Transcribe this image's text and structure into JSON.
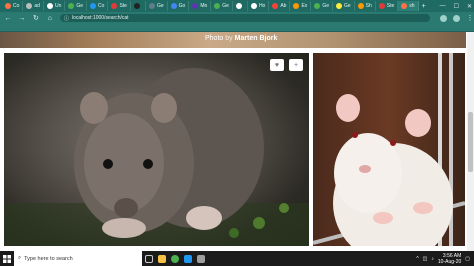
{
  "browser": {
    "tabs": [
      {
        "label": "Co",
        "color": "#ff7043"
      },
      {
        "label": "ad",
        "color": "#bdbdbd"
      },
      {
        "label": "Un",
        "color": "#ffffff"
      },
      {
        "label": "Ge",
        "color": "#4caf50"
      },
      {
        "label": "Co",
        "color": "#2196f3"
      },
      {
        "label": "Ste",
        "color": "#e53935"
      },
      {
        "label": "",
        "color": "#212121"
      },
      {
        "label": "Ge",
        "color": "#607d8b"
      },
      {
        "label": "Go",
        "color": "#4285f4"
      },
      {
        "label": "Mo",
        "color": "#5e35b1"
      },
      {
        "label": "Ge",
        "color": "#4caf50"
      },
      {
        "label": "",
        "color": "#ffffff"
      },
      {
        "label": "Ho",
        "color": "#ffffff"
      },
      {
        "label": "Ab",
        "color": "#f44336"
      },
      {
        "label": "Ex",
        "color": "#ff9800"
      },
      {
        "label": "Ge",
        "color": "#4caf50"
      },
      {
        "label": "Ge",
        "color": "#ffeb3b"
      },
      {
        "label": "Sh",
        "color": "#ff9800"
      },
      {
        "label": "Ste",
        "color": "#e53935"
      },
      {
        "label": "sh",
        "color": "#ff7043"
      }
    ],
    "new_tab": "+",
    "window_controls": {
      "minimize": "—",
      "maximize": "☐",
      "close": "✕"
    },
    "url": "localhost:1000/search/cat"
  },
  "page": {
    "banner_credit": {
      "prefix": "Photo",
      "by": "by",
      "author": "Marten Bjork"
    },
    "photo_actions": {
      "like": "♥",
      "add": "+"
    }
  },
  "taskbar": {
    "search_placeholder": "Type here to search",
    "time": "3:56 AM",
    "date": "10-Aug-20"
  }
}
